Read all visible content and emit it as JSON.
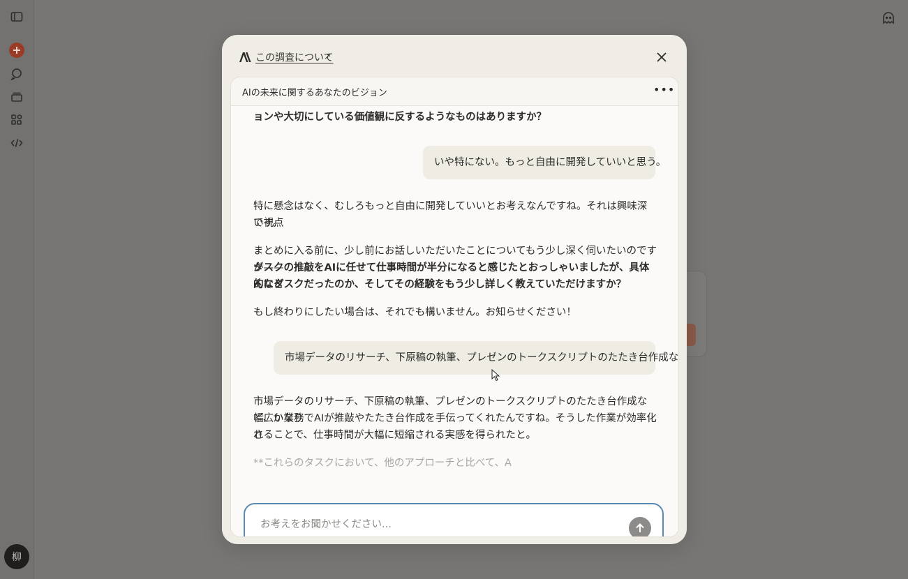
{
  "sidebar": {
    "icons": [
      "sidebar-toggle-icon",
      "plus-icon",
      "chat-search-icon",
      "projects-icon",
      "artifacts-icon",
      "code-icon"
    ],
    "avatar_initial": "柳"
  },
  "header_right_icon": "ghost-icon",
  "modal": {
    "about_link": "この調査について",
    "about_arrow": "↗",
    "chat_title": "AIの未来に関するあなたのビジョン",
    "more_label": "•••",
    "messages": {
      "m1_tail": "ョンや大切にしている価値観に反するようなものはありますか？",
      "u1": "いや特にない。もっと自由に開発していいと思う。",
      "a1_l1": "特に懸念はなく、むしろもっと自由に開発していいとお考えなんですね。それは興味深い視点",
      "a1_l2": "です。",
      "a2_l1": "まとめに入る前に、少し前にお話しいただいたことについてもう少し深く伺いたいのですが——",
      "a2_l2": "タスクの推敲をAIに任せて仕事時間が半分になると感じたとおっしゃいましたが、具体的にど",
      "a2_l3": "んなタスクだったのか、そしてその経験をもう少し詳しく教えていただけますか？",
      "a3": "もし終わりにしたい場合は、それでも構いません。お知らせください！",
      "u2": "市場データのリサーチ、下原稿の執筆、プレゼンのトークスクリプトのたたき台作成など",
      "a4_l1": "市場データのリサーチ、下原稿の執筆、プレゼンのトークスクリプトのたたき台作成など、かなり",
      "a4_l2": "幅広い業務でAIが推敲やたたき台作成を手伝ってくれたんですね。そうした作業が効率化さ",
      "a4_l3": "れることで、仕事時間が大幅に短縮される実感を得られたと。",
      "a5_partial": "**これらのタスクにおいて、他のアプローチと比べて、A"
    },
    "input_placeholder": "お考えをお聞かせください..."
  }
}
